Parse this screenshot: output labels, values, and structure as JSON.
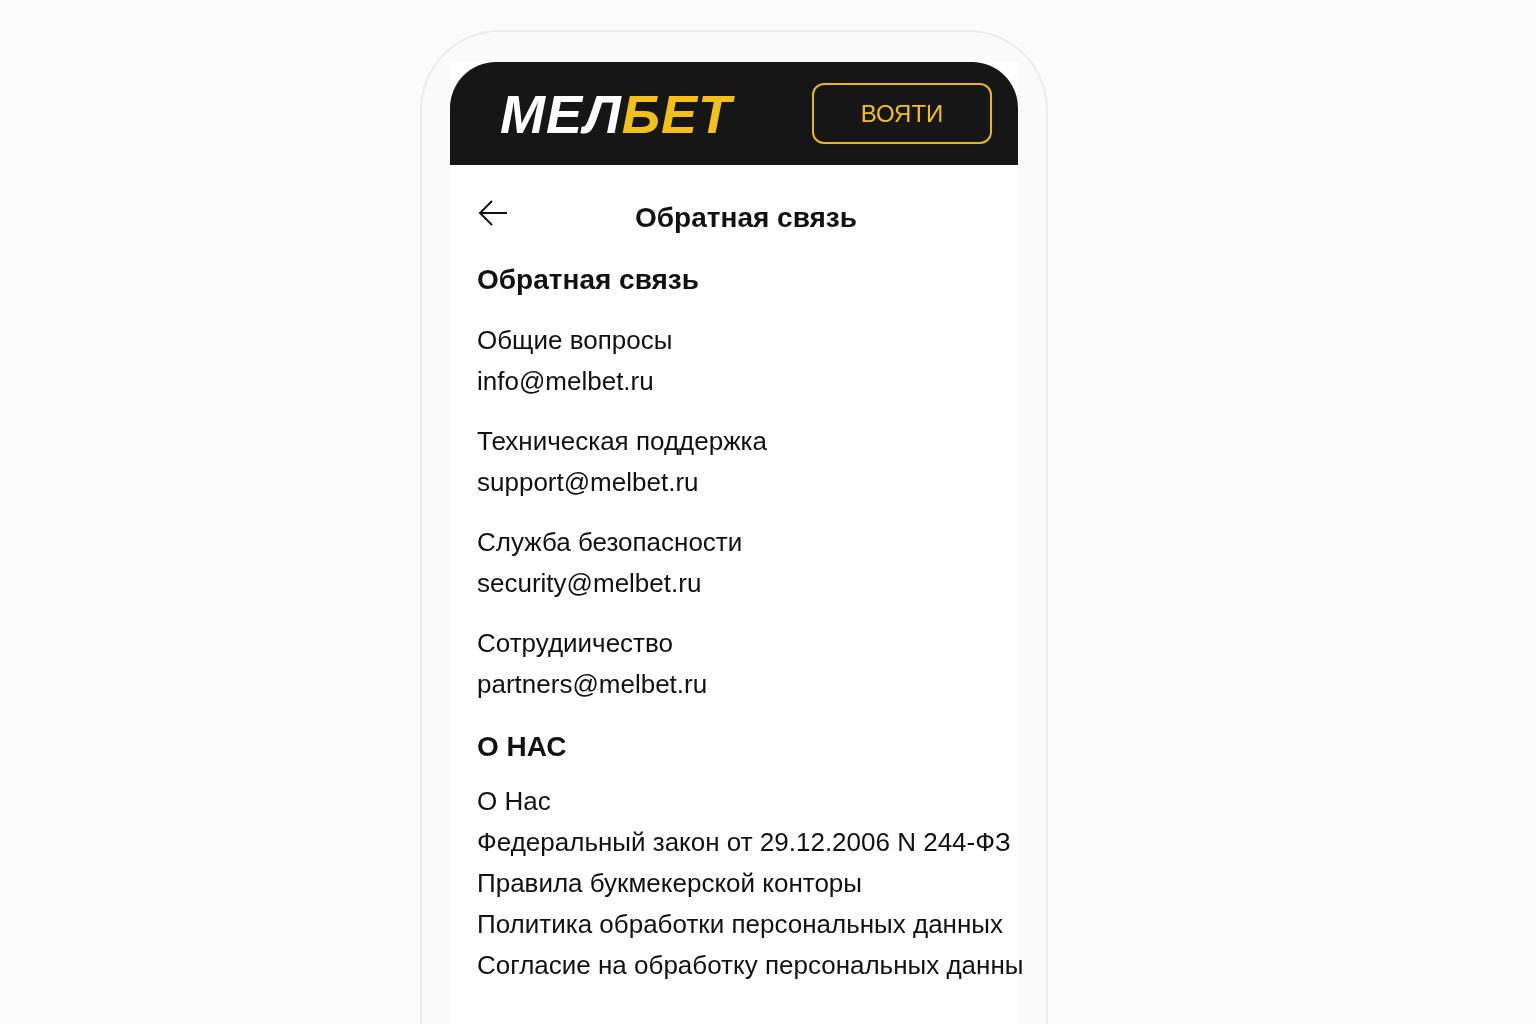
{
  "header": {
    "logo": [
      "МЕЛ",
      "БЕТ"
    ],
    "login_button": "ВОЯТИ"
  },
  "page_title": "Обратная связь",
  "feedback": {
    "heading": "Обратная связь",
    "contacts": [
      {
        "label": "Общие вопросы",
        "email": "info@melbet.ru"
      },
      {
        "label": "Техническая поддержка",
        "email": "support@melbet.ru"
      },
      {
        "label": "Служба безопасности",
        "email": "security@melbet.ru"
      },
      {
        "label": "Сотрудиичество",
        "email": "partners@melbet.ru"
      }
    ]
  },
  "about": {
    "heading": "О НАС",
    "links": [
      "О Нас",
      "Федеральный закон от 29.12.2006 N 244-ФЗ",
      "Правила букмекерской конторы",
      "Политика обработки персональных данных",
      "Согласие на обработку персональных данны"
    ]
  }
}
